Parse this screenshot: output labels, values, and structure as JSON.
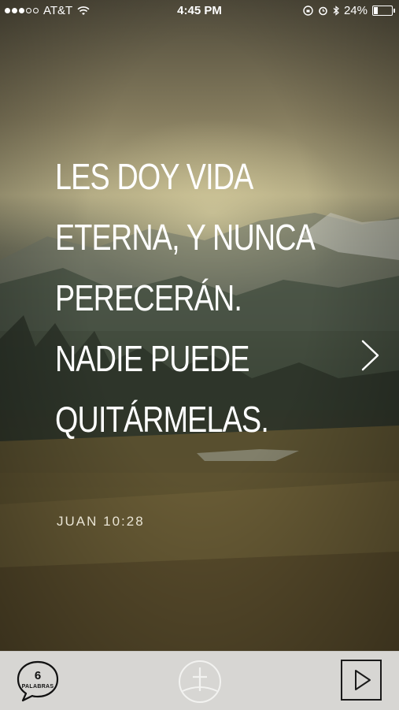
{
  "status_bar": {
    "carrier": "AT&T",
    "time": "4:45 PM",
    "battery": "24%",
    "battery_level": 0.24
  },
  "verse": {
    "lines": [
      "LES DOY VIDA",
      "ETERNA, Y NUNCA",
      "PERECERÁN.",
      "NADIE PUEDE",
      "QUITÁRMELAS."
    ],
    "reference": "JUAN 10:28"
  },
  "icons": {
    "next": "chevron-right-icon",
    "cross": "cross-icon",
    "play": "play-icon",
    "words": "speech-bubble-icon"
  },
  "toolbar": {
    "words_count": "6",
    "words_label": "PALABRAS"
  },
  "colors": {
    "toolbar_bg": "#d7d6d3",
    "text": "#ffffff"
  }
}
